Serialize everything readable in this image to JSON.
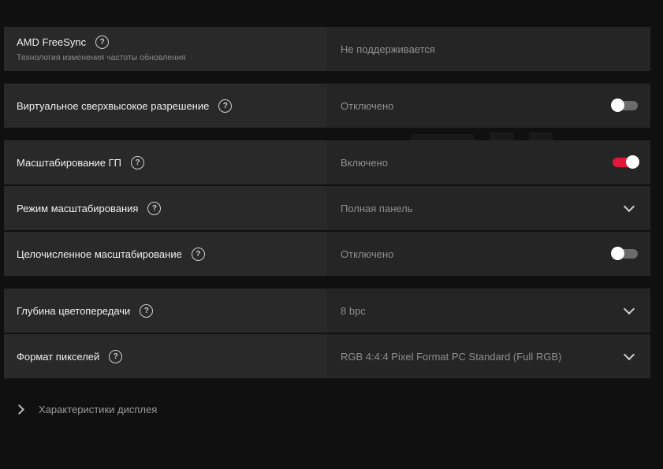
{
  "groups": [
    {
      "rows": [
        {
          "label": "AMD FreeSync",
          "sub": "Технология изменения частоты обновления",
          "value": "Не поддерживается",
          "control": "none"
        }
      ]
    },
    {
      "rows": [
        {
          "label": "Виртуальное сверхвысокое разрешение",
          "value": "Отключено",
          "control": "toggle",
          "state": "off"
        }
      ]
    },
    {
      "rows": [
        {
          "label": "Масштабирование ГП",
          "value": "Включено",
          "control": "toggle",
          "state": "on"
        },
        {
          "label": "Режим масштабирования",
          "value": "Полная панель",
          "control": "dropdown"
        },
        {
          "label": "Целочисленное масштабирование",
          "value": "Отключено",
          "control": "toggle",
          "state": "off"
        }
      ]
    },
    {
      "rows": [
        {
          "label": "Глубина цветопередачи",
          "value": "8 bpc",
          "control": "dropdown"
        },
        {
          "label": "Формат пикселей",
          "value": "RGB 4:4:4 Pixel Format PC Standard (Full RGB)",
          "control": "dropdown"
        }
      ]
    }
  ],
  "help_glyph": "?",
  "footer": {
    "label": "Характеристики дисплея",
    "icon": "chevron-right-icon"
  },
  "colors": {
    "accent": "#e3173a",
    "background": "#101010",
    "panel": "#292929"
  }
}
